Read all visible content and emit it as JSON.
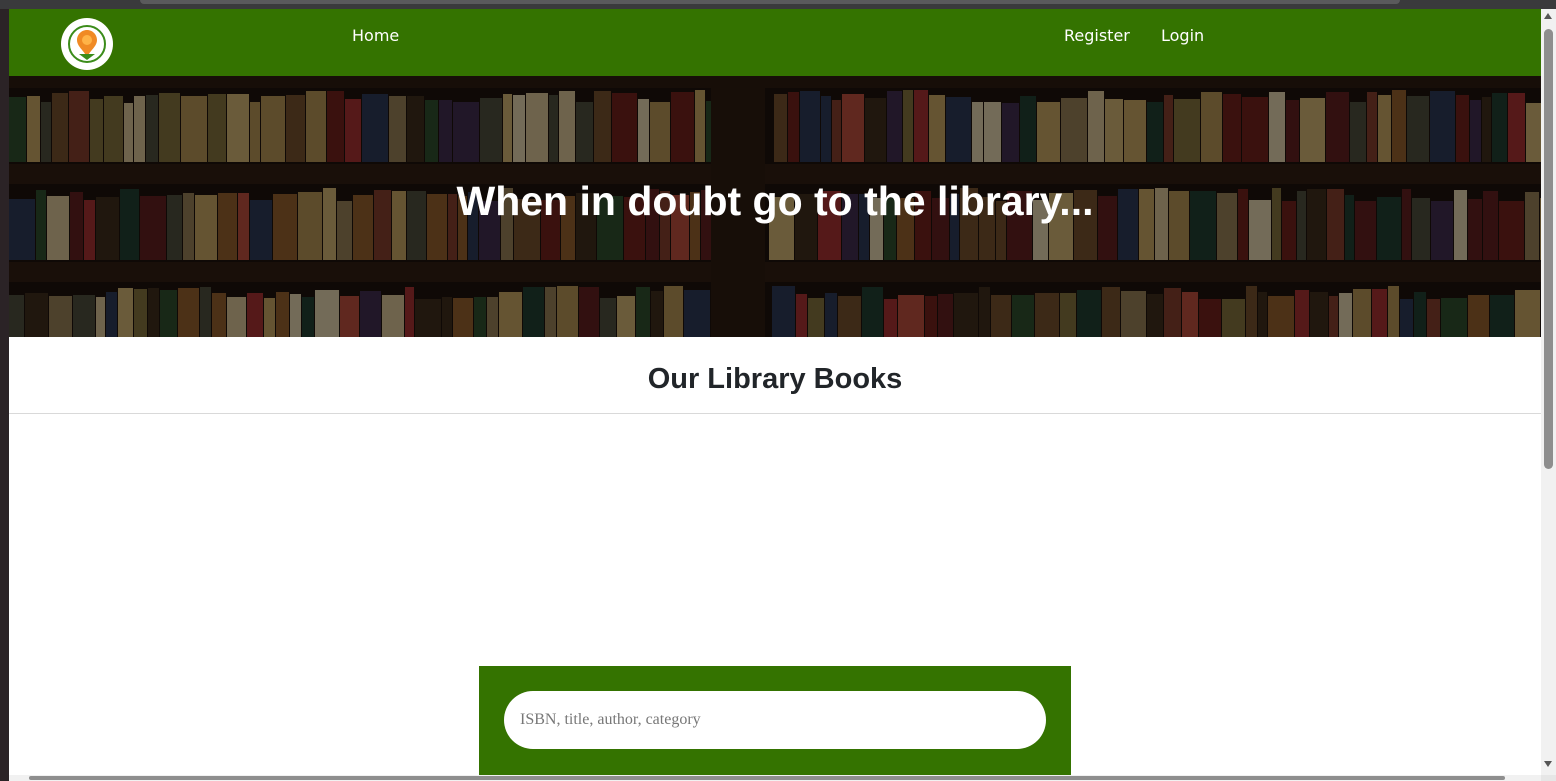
{
  "navbar": {
    "logo_icon": "library-logo-icon",
    "home_label": "Home",
    "register_label": "Register",
    "login_label": "Login",
    "bg_color": "#347300"
  },
  "hero": {
    "title": "When in doubt go to the library..."
  },
  "main": {
    "section_title": "Our Library Books"
  },
  "search": {
    "placeholder": "ISBN, title, author, category",
    "value": ""
  }
}
